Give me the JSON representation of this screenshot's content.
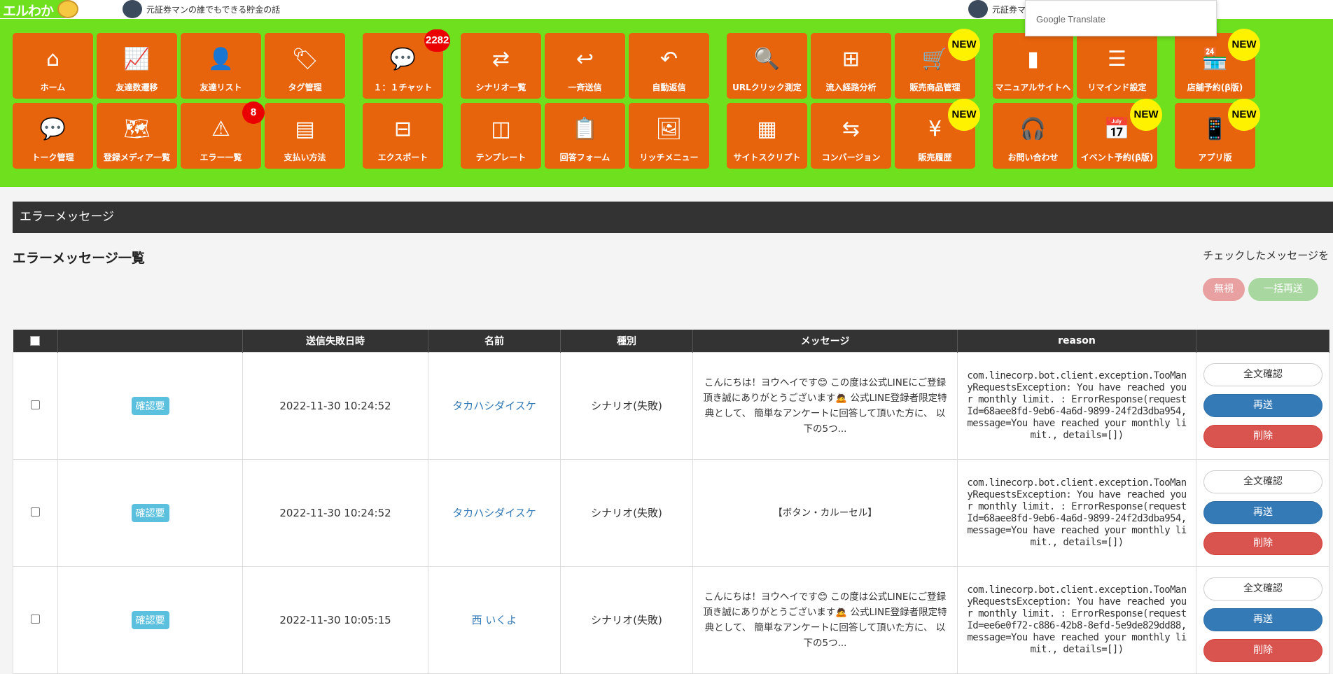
{
  "header": {
    "logo_text": "エルわか",
    "account_left": "元証券マンの誰でもできる貯金の話",
    "account_right": "元証券マ",
    "translate_label": "Google Translate"
  },
  "nav": {
    "row1": [
      {
        "label": "ホーム",
        "icon": "⌂",
        "icon_name": "home-icon"
      },
      {
        "label": "友達数遷移",
        "icon": "📈",
        "icon_name": "line-chart-icon"
      },
      {
        "label": "友達リスト",
        "icon": "👤",
        "icon_name": "user-icon"
      },
      {
        "label": "タグ管理",
        "icon": "🏷",
        "icon_name": "tags-icon"
      },
      {
        "label": "１：１チャット",
        "icon": "💬",
        "icon_name": "chat-icon",
        "badge": "2282"
      },
      {
        "label": "シナリオ一覧",
        "icon": "⇄",
        "icon_name": "shuffle-icon"
      },
      {
        "label": "一斉送信",
        "icon": "↩",
        "icon_name": "reply-icon"
      },
      {
        "label": "自動返信",
        "icon": "↶",
        "icon_name": "undo-icon"
      },
      {
        "label": "URLクリック測定",
        "icon": "🔍",
        "icon_name": "analytics-icon"
      },
      {
        "label": "流入経路分析",
        "icon": "⊞",
        "icon_name": "sitemap-icon"
      },
      {
        "label": "販売商品管理",
        "icon": "🛒",
        "icon_name": "cart-icon",
        "new": "NEW"
      },
      {
        "label": "マニュアルサイトへ",
        "icon": "▮",
        "icon_name": "file-icon"
      },
      {
        "label": "リマインド設定",
        "icon": "☰",
        "icon_name": "list-icon"
      },
      {
        "label": "店舗予約(β版)",
        "icon": "🏪",
        "icon_name": "store-icon",
        "new": "NEW"
      }
    ],
    "row2": [
      {
        "label": "トーク管理",
        "icon": "💬",
        "icon_name": "comment-icon"
      },
      {
        "label": "登録メディア一覧",
        "icon": "🗺",
        "icon_name": "map-icon"
      },
      {
        "label": "エラー一覧",
        "icon": "⚠",
        "icon_name": "warning-icon",
        "badge": "8"
      },
      {
        "label": "支払い方法",
        "icon": "▤",
        "icon_name": "card-icon"
      },
      {
        "label": "エクスポート",
        "icon": "⊟",
        "icon_name": "hdd-icon"
      },
      {
        "label": "テンプレート",
        "icon": "◫",
        "icon_name": "columns-icon"
      },
      {
        "label": "回答フォーム",
        "icon": "📋",
        "icon_name": "clipboard-icon"
      },
      {
        "label": "リッチメニュー",
        "icon": "🖼",
        "icon_name": "image-icon"
      },
      {
        "label": "サイトスクリプト",
        "icon": "▦",
        "icon_name": "browser-icon"
      },
      {
        "label": "コンバージョン",
        "icon": "⇆",
        "icon_name": "exchange-icon"
      },
      {
        "label": "販売履歴",
        "icon": "¥",
        "icon_name": "money-bag-icon",
        "new": "NEW"
      },
      {
        "label": "お問い合わせ",
        "icon": "🎧",
        "icon_name": "headset-icon"
      },
      {
        "label": "イベント予約(β版)",
        "icon": "📅",
        "icon_name": "calendar-icon",
        "new": "NEW"
      },
      {
        "label": "アプリ版",
        "icon": "📱",
        "icon_name": "mobile-icon",
        "new": "NEW"
      }
    ]
  },
  "section": {
    "title": "エラーメッセージ",
    "list_title": "エラーメッセージ一覧",
    "checked_label": "チェックしたメッセージを",
    "ignore_button": "無視",
    "bulk_resend_button": "一括再送"
  },
  "table": {
    "headers": [
      "",
      "",
      "送信失敗日時",
      "名前",
      "種別",
      "メッセージ",
      "reason",
      ""
    ],
    "rows": [
      {
        "status": "確認要",
        "date": "2022-11-30 10:24:52",
        "name": "タカハシダイスケ",
        "type": "シナリオ(失敗)",
        "message": "こんにちは！ヨウヘイです😊 この度は公式LINEにご登録頂き誠にありがとうございます🙇 公式LINE登録者限定特典として、 簡単なアンケートに回答して頂いた方に、 以下の5つ...",
        "reason": "com.linecorp.bot.client.exception.TooManyRequestsException: You have reached your monthly limit. : ErrorResponse(requestId=68aee8fd-9eb6-4a6d-9899-24f2d3dba954, message=You have reached your monthly limit., details=[])",
        "view": "全文確認",
        "resend": "再送",
        "delete": "削除"
      },
      {
        "status": "確認要",
        "date": "2022-11-30 10:24:52",
        "name": "タカハシダイスケ",
        "type": "シナリオ(失敗)",
        "message": "【ボタン・カルーセル】",
        "reason": "com.linecorp.bot.client.exception.TooManyRequestsException: You have reached your monthly limit. : ErrorResponse(requestId=68aee8fd-9eb6-4a6d-9899-24f2d3dba954, message=You have reached your monthly limit., details=[])",
        "view": "全文確認",
        "resend": "再送",
        "delete": "削除"
      },
      {
        "status": "確認要",
        "date": "2022-11-30 10:05:15",
        "name": "西 いくよ",
        "type": "シナリオ(失敗)",
        "message": "こんにちは！ヨウヘイです😊 この度は公式LINEにご登録頂き誠にありがとうございます🙇 公式LINE登録者限定特典として、 簡単なアンケートに回答して頂いた方に、 以下の5つ...",
        "reason": "com.linecorp.bot.client.exception.TooManyRequestsException: You have reached your monthly limit. : ErrorResponse(requestId=ee6e0f72-c886-42b8-8efd-5e9de829dd88, message=You have reached your monthly limit., details=[])",
        "view": "全文確認",
        "resend": "再送",
        "delete": "削除"
      }
    ]
  },
  "colors": {
    "nav_bg": "#6ee01e",
    "tile": "#e8640c",
    "dark_bar": "#333333",
    "badge_new": "#fff200",
    "badge_count": "#ea0000"
  }
}
